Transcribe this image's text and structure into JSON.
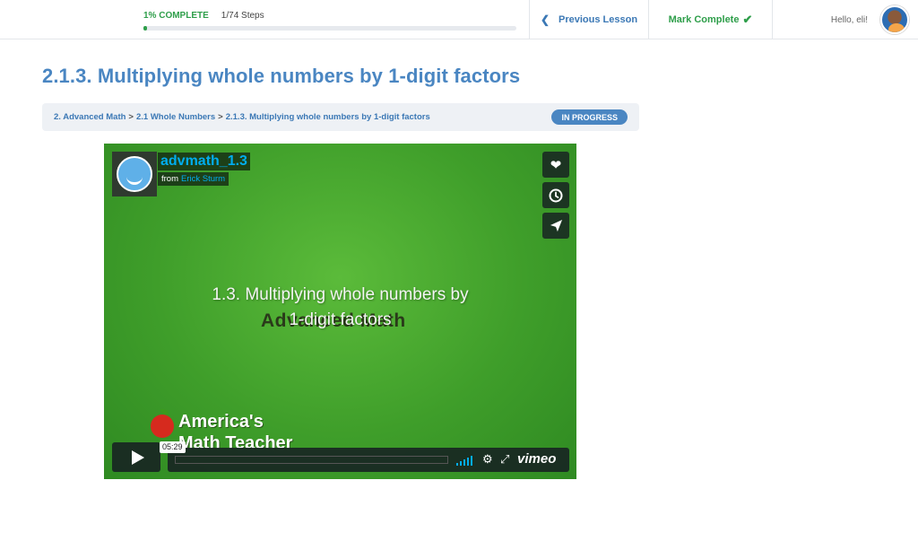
{
  "header": {
    "progress_label": "1% COMPLETE",
    "progress_steps": "1/74 Steps",
    "progress_fraction": 0.01,
    "prev_lesson": "Previous Lesson",
    "mark_complete": "Mark Complete",
    "greeting": "Hello, eli!"
  },
  "lesson": {
    "title": "2.1.3. Multiplying whole numbers by 1-digit factors",
    "breadcrumbs": [
      "2. Advanced Math",
      "2.1 Whole Numbers",
      "2.1.3. Multiplying whole numbers by 1-digit factors"
    ],
    "status": "IN PROGRESS"
  },
  "video": {
    "brand_text": "Advanced Math",
    "title": "advmath_1.3",
    "from_label": "from",
    "author": "Erick Sturm",
    "center_line1": "1.3.  Multiplying whole numbers by",
    "center_line2": "1-digit factors",
    "logo_line1": "America's",
    "logo_line2": "Math Teacher",
    "duration": "05:29",
    "player_brand": "vimeo",
    "icons": {
      "like": "heart-icon",
      "watch_later": "clock-icon",
      "share": "paper-plane-icon",
      "settings": "gear-icon",
      "fullscreen": "fullscreen-icon"
    }
  },
  "colors": {
    "accent_blue": "#4a86c2",
    "success_green": "#2e9e4a",
    "vimeo_blue": "#00adef"
  }
}
